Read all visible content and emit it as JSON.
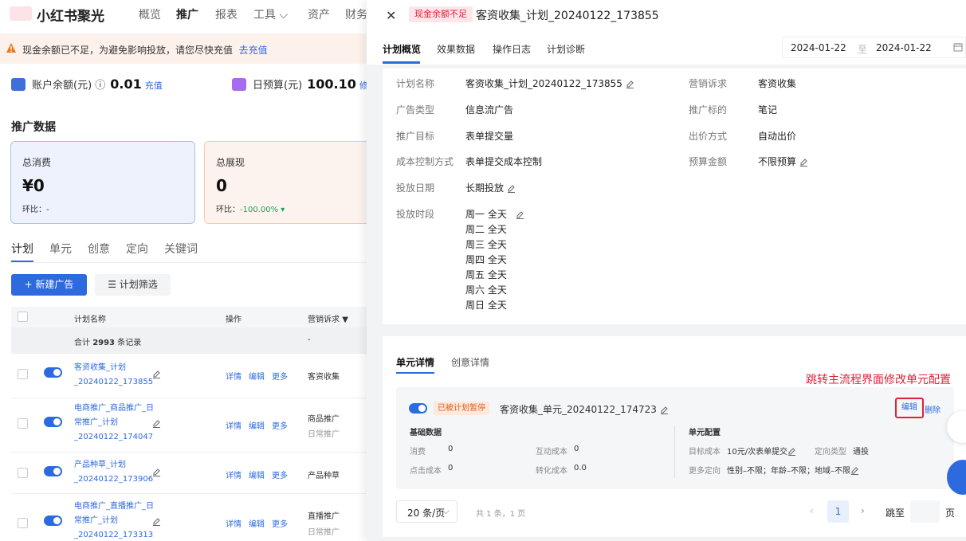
{
  "brand": {
    "name": "小红书聚光"
  },
  "nav": [
    "概览",
    "推广",
    "报表",
    "工具 ⌵",
    "资产",
    "财务"
  ],
  "alert": {
    "text": "现金余额已不足，为避免影响投放，请您尽快充值",
    "link": "去充值"
  },
  "account": {
    "balance_label": "账户余额(元) ⓘ",
    "balance_value": "0.01",
    "balance_link": "充值",
    "budget_label": "日预算(元)",
    "budget_value": "100.10",
    "budget_link": "修改"
  },
  "section_title": "推广数据",
  "cards": [
    {
      "label": "总消费",
      "value": "¥0",
      "change_label": "环比：",
      "change_value": "-"
    },
    {
      "label": "总展现",
      "value": "0",
      "change_label": "环比：",
      "change_value": "-100.00% ▾"
    }
  ],
  "subtabs": [
    "计划",
    "单元",
    "创意",
    "定向",
    "关键词"
  ],
  "buttons": {
    "new_ad": "+ 新建广告",
    "filter": "计划筛选"
  },
  "table": {
    "headers": {
      "name": "计划名称",
      "ops": "操作",
      "cat": "营销诉求"
    },
    "summary": {
      "prefix": "合计",
      "count": "2993",
      "suffix": "条记录",
      "cat": "-"
    },
    "rows": [
      {
        "name": "客资收集_计划_20240122_173855",
        "ops": [
          "详情",
          "编辑",
          "更多"
        ],
        "cat": "客资收集",
        "cat2": ""
      },
      {
        "name": "电商推广_商品推广_日常推广_计划_20240122_174047",
        "ops": [
          "详情",
          "编辑",
          "更多"
        ],
        "cat": "商品推广",
        "cat2": "日常推广"
      },
      {
        "name": "产品种草_计划_20240122_173906",
        "ops": [
          "详情",
          "编辑",
          "更多"
        ],
        "cat": "产品种草",
        "cat2": ""
      },
      {
        "name": "电商推广_直播推广_日常推广_计划_20240122_173313",
        "ops": [
          "详情",
          "编辑",
          "更多"
        ],
        "cat": "直播推广",
        "cat2": "日常推广"
      }
    ]
  },
  "panel": {
    "close": "✕",
    "badge": "现金余额不足",
    "title": "客资收集_计划_20240122_173855",
    "tabs": [
      "计划概览",
      "效果数据",
      "操作日志",
      "计划诊断"
    ],
    "date_start": "2024-01-22",
    "date_sep": "至",
    "date_end": "2024-01-22",
    "info_left": [
      {
        "k": "计划名称",
        "v": "客资收集_计划_20240122_173855"
      },
      {
        "k": "广告类型",
        "v": "信息流广告"
      },
      {
        "k": "推广目标",
        "v": "表单提交量"
      },
      {
        "k": "成本控制方式",
        "v": "表单提交成本控制"
      },
      {
        "k": "投放日期",
        "v": "长期投放"
      },
      {
        "k": "投放时段",
        "v": "周一  全天"
      }
    ],
    "days": [
      "周二  全天",
      "周三  全天",
      "周四  全天",
      "周五  全天",
      "周六  全天",
      "周日  全天"
    ],
    "info_right": [
      {
        "k": "营销诉求",
        "v": "客资收集"
      },
      {
        "k": "推广标的",
        "v": "笔记"
      },
      {
        "k": "出价方式",
        "v": "自动出价"
      },
      {
        "k": "预算金额",
        "v": "不限预算"
      }
    ],
    "unit_tabs": [
      "单元详情",
      "创意详情"
    ],
    "annotation": "跳转主流程界面修改单元配置",
    "unit": {
      "status": "已被计划暂停",
      "name": "客资收集_单元_20240122_174723",
      "edit": "编辑",
      "delete": "删除",
      "basic_title": "基础数据",
      "config_title": "单元配置",
      "basic": [
        {
          "k": "消费",
          "v": "0"
        },
        {
          "k": "互动成本",
          "v": "0"
        },
        {
          "k": "点击成本",
          "v": "0"
        },
        {
          "k": "转化成本",
          "v": "0.0"
        }
      ],
      "config": {
        "target_k": "目标成本",
        "target_v": "10元/次表单提交",
        "type_k": "定向类型",
        "type_v": "通投",
        "more_k": "更多定向",
        "more_v": "性别–不限；年龄–不限；地域–不限"
      }
    },
    "pager": {
      "size": "20 条/页",
      "info": "共 1 条，1 页",
      "current": "1",
      "jump": "跳至",
      "page": "页"
    }
  }
}
